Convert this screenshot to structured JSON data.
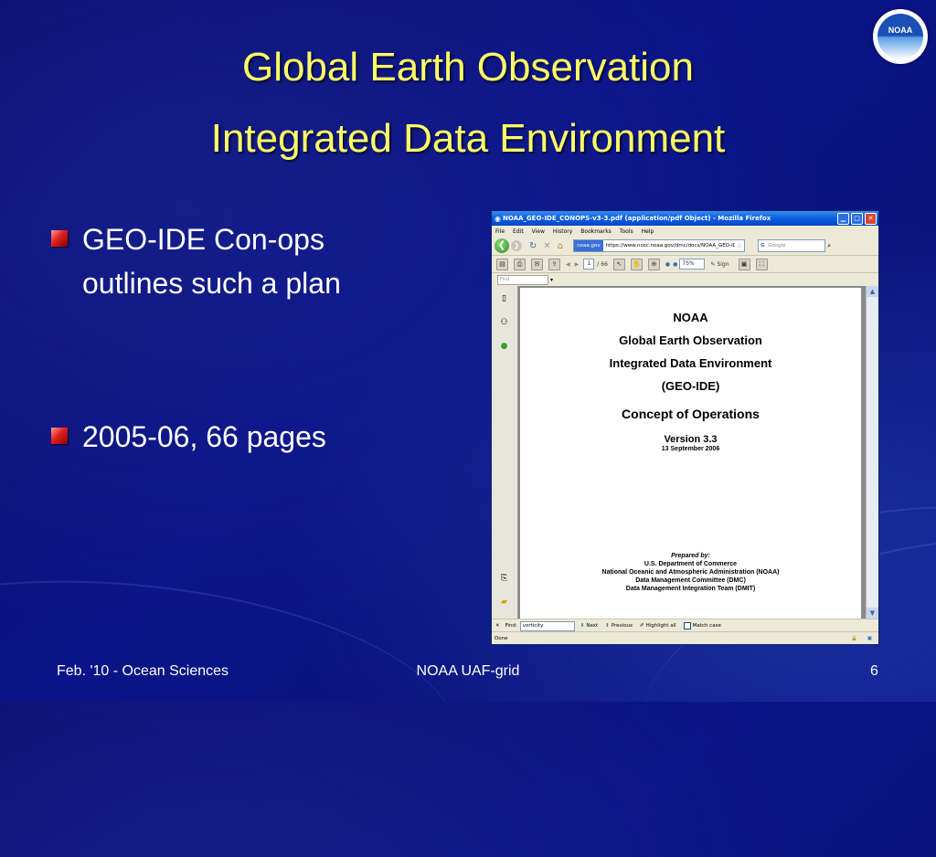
{
  "slide": {
    "title_line1": "Global Earth Observation",
    "title_line2": "Integrated Data Environment",
    "logo_text": "NOAA",
    "bullets": [
      {
        "line1": "GEO-IDE Con-ops",
        "line2": "outlines such a plan"
      },
      {
        "line1": "2005-06,  66 pages"
      }
    ],
    "footer": {
      "left": "Feb. '10 - Ocean Sciences",
      "center": "NOAA UAF-grid",
      "right": "6"
    }
  },
  "browser": {
    "title": "NOAA_GEO-IDE_CONOPS-v3-3.pdf (application/pdf Object) - Mozilla Firefox",
    "menu": [
      "File",
      "Edit",
      "View",
      "History",
      "Bookmarks",
      "Tools",
      "Help"
    ],
    "site_badge": "noaa.gov",
    "url": "https://www.nosc.noaa.gov/dmc/docs/NOAA_GEO-IDE_CC",
    "search_placeholder": "Google",
    "pdf": {
      "page_number": "1",
      "page_total": "66",
      "zoom": "75%",
      "sign_label": "Sign",
      "find_placeholder": "Find"
    },
    "document": {
      "org": "NOAA",
      "line1": "Global Earth Observation",
      "line2": "Integrated Data Environment",
      "line3": "(GEO-IDE)",
      "doc_title": "Concept of Operations",
      "version": "Version 3.3",
      "date": "13 September 2006",
      "prepared_by": "Prepared by:",
      "preparers": [
        "U.S. Department of Commerce",
        "National Oceanic and Atmospheric Administration (NOAA)",
        "Data Management Committee (DMC)",
        "Data Management Integration Team (DMIT)"
      ]
    },
    "findbar": {
      "label": "Find:",
      "value": "vorticity",
      "next": "Next",
      "previous": "Previous",
      "highlight": "Highlight all",
      "match_case": "Match case"
    },
    "status": "Done"
  }
}
